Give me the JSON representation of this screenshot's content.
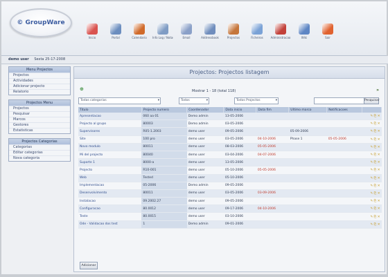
{
  "app": {
    "logo_text": "© GroupWare"
  },
  "toolbar": [
    {
      "label": "Inicio",
      "icon": "home-icon",
      "color": "#d9534f"
    },
    {
      "label": "Portal",
      "icon": "portal-icon",
      "color": "#6c8ebf"
    },
    {
      "label": "Calendario",
      "icon": "calendar-icon",
      "color": "#d06a2a"
    },
    {
      "label": "Info Log / Notas",
      "icon": "notes-icon",
      "color": "#7f9cc4"
    },
    {
      "label": "Email",
      "icon": "email-icon",
      "color": "#8aa0c8"
    },
    {
      "label": "Addressbook",
      "icon": "addressbook-icon",
      "color": "#6f8dbd"
    },
    {
      "label": "Projectos",
      "icon": "projects-icon",
      "color": "#c5763b"
    },
    {
      "label": "Ficheiros",
      "icon": "files-icon",
      "color": "#7aa2d6"
    },
    {
      "label": "Administracao",
      "icon": "admin-icon",
      "color": "#c2413a"
    },
    {
      "label": "Wiki",
      "icon": "wiki-icon",
      "color": "#5e86c4"
    },
    {
      "label": "Sair",
      "icon": "logout-icon",
      "color": "#e0622f"
    }
  ],
  "userbar": {
    "user": "demo user",
    "date": "Sexta 25-17-2008"
  },
  "sidebar": [
    {
      "title": "Menu Projectos",
      "items": [
        "Projectos",
        "Actividades",
        "Adicionar projecto",
        "Relatorio"
      ]
    },
    {
      "title": "Projectos Menu",
      "items": [
        "Projectos",
        "Pesquisar",
        "Marcos",
        "Gestores",
        "Estatisticas"
      ]
    },
    {
      "title": "Projectos Categorias",
      "items": [
        "Categorias",
        "Editar categorias",
        "Nova categoria"
      ]
    }
  ],
  "main": {
    "title": "Projectos: Projectos listagem",
    "range": "Mostrar 1 - 18 (total 118)",
    "nav": "»",
    "filters": {
      "category": "Todas categorias",
      "status": "Todos",
      "projects": "Todos Projectos",
      "search_btn": "Pesquisar"
    },
    "columns": [
      "Titulo",
      "Projecto numero",
      "Coordenador",
      "Data inicio",
      "Data fim",
      "Ultimo marco",
      "Notificacoes"
    ],
    "rows": [
      [
        "Apresentacao",
        "060 aa 01",
        "Demo admin",
        "13-05-2006",
        "",
        "",
        ""
      ],
      [
        "Projecto al grupo",
        "80003",
        "Demo admin",
        "03-05-2006",
        "",
        "",
        ""
      ],
      [
        "Supervisores",
        "R05-1.2003",
        "demo user",
        "09-05-2006",
        "",
        "05-09-2006",
        ""
      ],
      [
        "Site",
        "100 pro",
        "demo user",
        "03-05-2006",
        "04-10-2006",
        "Phase 1",
        "05-05-2006"
      ],
      [
        "Novo modulo",
        "80011",
        "demo user",
        "08-03-2006",
        "05-05-2006",
        "",
        ""
      ],
      [
        "Mi del projecto",
        "80040",
        "demo user",
        "03-04-2006",
        "04-07-2006",
        "",
        ""
      ],
      [
        "Suporte 1",
        "8000-a",
        "demo user",
        "13-05-2006",
        "",
        "",
        ""
      ],
      [
        "Projecto",
        "R10-001",
        "demo user",
        "05-10-2006",
        "05-05-2006",
        "",
        ""
      ],
      [
        "Web",
        "Tested",
        "demo user",
        "05-10-2006",
        "",
        "",
        ""
      ],
      [
        "Implementacao",
        "05-2006",
        "Demo admin",
        "09-05-2006",
        "",
        "",
        ""
      ],
      [
        "Desenvolvimento",
        "80011",
        "demo user",
        "03-05-2006",
        "03-09-2006",
        "",
        ""
      ],
      [
        "Instalacao",
        "09.2002.27",
        "demo user",
        "09-05-2006",
        "",
        "",
        ""
      ],
      [
        "Configuracao",
        "80.0012",
        "demo user",
        "09-17-2006",
        "04-10-2006",
        "",
        ""
      ],
      [
        "Teste",
        "80.0015",
        "demo user",
        "03-10-2006",
        "",
        "",
        ""
      ],
      [
        "Ode - Validacao dos test",
        "1",
        "Demo admin",
        "09-01-2006",
        "",
        "",
        ""
      ]
    ],
    "bottom_btn": "Adicionar"
  }
}
